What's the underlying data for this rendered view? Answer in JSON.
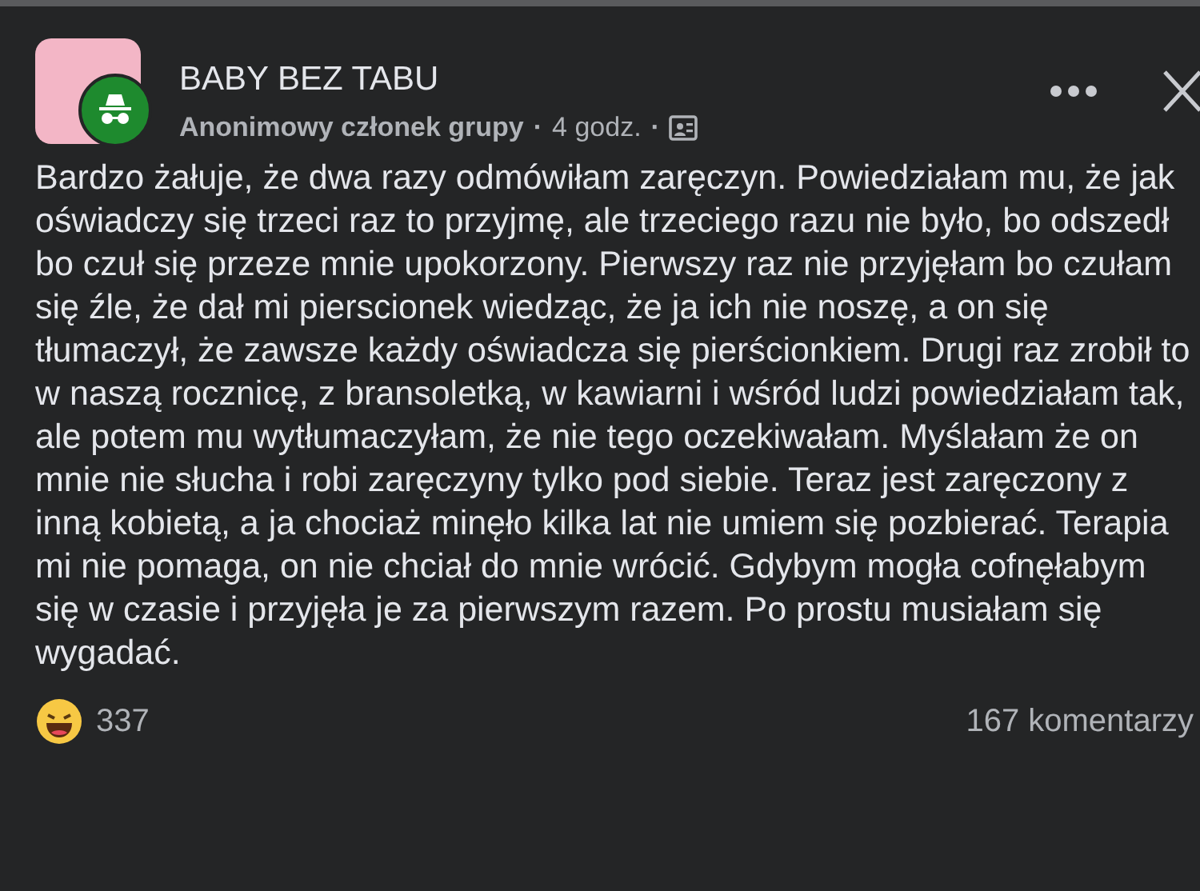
{
  "post": {
    "group_name": "BABY BEZ TABU",
    "author": "Anonimowy członek grupy",
    "separator_1": "·",
    "time": "4 godz.",
    "separator_2": "·",
    "body": "Bardzo żałuje, że dwa razy odmówiłam zaręczyn. Powiedziałam mu, że jak oświadczy się trzeci raz to przyjmę, ale trzeciego razu nie było, bo odszedł bo czuł się przeze mnie upokorzony. Pierwszy raz nie przyjęłam bo czułam się źle, że dał mi pierscionek wiedząc, że ja ich nie noszę, a on się tłumaczył, że zawsze każdy oświadcza się pierścionkiem. Drugi raz zrobił to w naszą rocznicę, z bransoletką, w kawiarni i wśród ludzi powiedziałam tak, ale potem mu wytłumaczyłam, że nie tego oczekiwałam. Myślałam że on mnie nie słucha i robi zaręczyny tylko pod siebie. Teraz jest zaręczony z inną kobietą, a ja chociaż minęło kilka lat nie umiem się pozbierać. Terapia mi nie pomaga, on nie chciał do mnie wrócić. Gdybym mogła cofnęłabym się w czasie i przyjęła je za pierwszym razem. Po prostu musiałam się wygadać.",
    "reaction_count": "337",
    "comments": "167 komentarzy"
  }
}
